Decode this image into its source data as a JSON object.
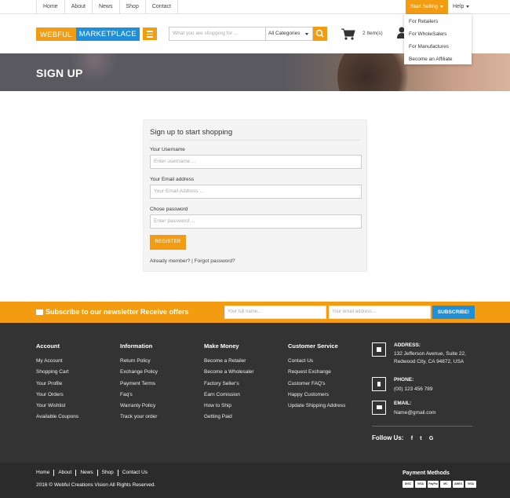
{
  "topbar": {
    "nav": [
      "Home",
      "About",
      "News",
      "Shop",
      "Contact"
    ],
    "start_selling": "Start Selling",
    "help": "Help",
    "dropdown": [
      "For Retailers",
      "For WholeSalers",
      "For Manufactures",
      "Become an Affiliate"
    ]
  },
  "header": {
    "logo_part1": "WEBFUL",
    "logo_part2": "MARKETPLACE",
    "search_placeholder": "What you are shopping for ...",
    "category": "All Categories",
    "cart_items": "2 Item(s)",
    "icons": [
      "menu-icon",
      "search-icon",
      "cart-icon",
      "user-icon"
    ]
  },
  "banner": {
    "title": "SIGN UP"
  },
  "form": {
    "heading": "Sign up to start shopping",
    "username_label": "Your Username",
    "username_placeholder": "Enter username ...",
    "email_label": "Your Email address",
    "email_placeholder": "Your Email Address ...",
    "password_label": "Chose password",
    "password_placeholder": "Enter password ...",
    "register": "REGISTER",
    "already_member": "Already member?",
    "forgot": "Forgot password?"
  },
  "newsletter": {
    "title": "Subscribe to our newsletter Receive offers",
    "name_placeholder": "Your full name...",
    "email_placeholder": "Your email address...",
    "button": "SUBSCRIBE!"
  },
  "footer": {
    "columns": [
      {
        "title": "Account",
        "links": [
          "My Account",
          "Shopping Cart",
          "Your Profile",
          "Your Orders",
          "Your Wishlist",
          "Available Coupons"
        ]
      },
      {
        "title": "Information",
        "links": [
          "Return Policy",
          "Exchange Policy",
          "Payment Terms",
          "Faq's",
          "Warranty Policy",
          "Track your order"
        ]
      },
      {
        "title": "Make Money",
        "links": [
          "Become a Retailer",
          "Become a Wholesaler",
          "Factory Seller's",
          "Earn Comission",
          "How to Ship",
          "Getting Paid"
        ]
      },
      {
        "title": "Customer Service",
        "links": [
          "Contact Us",
          "Request Exchange",
          "Customer FAQ's",
          "Happy Customers",
          "Update Shipping Address"
        ]
      }
    ],
    "address_title": "ADDRESS:",
    "address": "132 Jefferson Avenue, Suite 22, Redwood City, CA 94872, USA",
    "phone_title": "PHONE:",
    "phone": "(00) 123 456 789",
    "email_title": "EMAIL:",
    "email": "Name@gmail.com",
    "follow_us": "Follow Us:",
    "social": [
      "f",
      "t",
      "G"
    ]
  },
  "bottom": {
    "nav": [
      "Home",
      "About",
      "News",
      "Shop",
      "Contact Us"
    ],
    "copyright": "2016 © Webful Creations Vision All Rights Reserved.",
    "payment_title": "Payment Methods",
    "cards": [
      "DISC",
      "VISA",
      "PayPal",
      "MC",
      "AMEX",
      "VISA"
    ]
  },
  "colors": {
    "accent": "#f39c12",
    "blue": "#1e8fd8",
    "footer": "#333333",
    "bottom": "#2b2b2b"
  }
}
